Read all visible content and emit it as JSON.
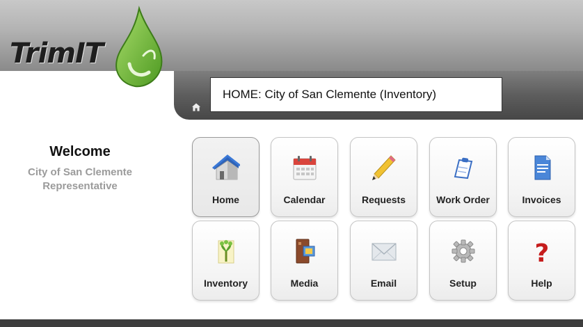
{
  "brand": {
    "name": "TrimIT"
  },
  "location": {
    "text": "HOME: City of San Clemente (Inventory)"
  },
  "welcome": {
    "title": "Welcome",
    "org": "City of San Clemente",
    "role": "Representative"
  },
  "tiles": [
    {
      "label": "Home",
      "icon": "house-icon"
    },
    {
      "label": "Calendar",
      "icon": "calendar-icon"
    },
    {
      "label": "Requests",
      "icon": "pencil-icon"
    },
    {
      "label": "Work Order",
      "icon": "clipboard-icon"
    },
    {
      "label": "Invoices",
      "icon": "document-icon"
    },
    {
      "label": "Inventory",
      "icon": "tree-icon"
    },
    {
      "label": "Media",
      "icon": "media-icon"
    },
    {
      "label": "Email",
      "icon": "envelope-icon"
    },
    {
      "label": "Setup",
      "icon": "gear-icon"
    },
    {
      "label": "Help",
      "icon": "question-mark-icon"
    }
  ],
  "colors": {
    "accent_green": "#7cc242",
    "header_gray": "#8a8a8a",
    "strip_dark": "#474747"
  }
}
